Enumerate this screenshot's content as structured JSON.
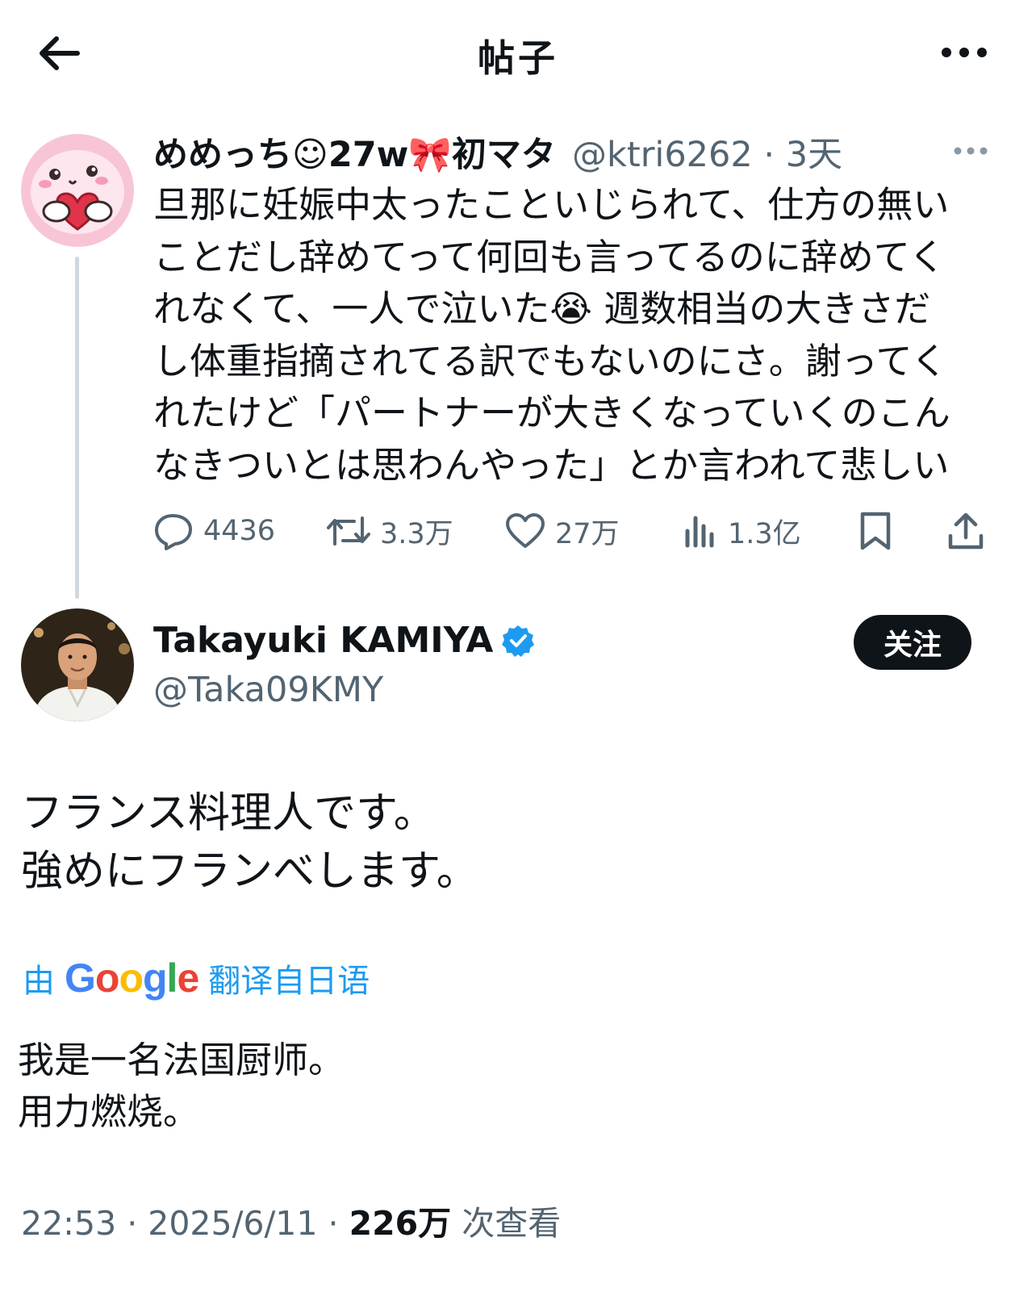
{
  "header": {
    "title": "帖子"
  },
  "parent_tweet": {
    "display_name": "めめっち☺27w🎀初マタ",
    "handle_time": "@ktri6262 · 3天",
    "text_lines": [
      "旦那に妊娠中太ったこといじられて、仕方の無い",
      "ことだし辞めてって何回も言ってるのに辞めてく",
      "れなくて、一人で泣いた😭 週数相当の大きさだ",
      "し体重指摘されてる訳でもないのにさ。謝ってく",
      "れたけど「パートナーが大きくなっていくのこん",
      "なきついとは思わんやった」とか言われて悲しい"
    ],
    "stats": {
      "replies": "4436",
      "reposts": "3.3万",
      "likes": "27万",
      "views": "1.3亿"
    }
  },
  "main_tweet": {
    "display_name": "Takayuki KAMIYA",
    "handle": "@Taka09KMY",
    "follow_label": "关注",
    "text_lines": [
      "フランス料理人です。",
      "強めにフランべします。"
    ],
    "translate": {
      "prefix": "由",
      "brand": "Google",
      "suffix": "翻译自日语"
    },
    "translated_lines": [
      "我是一名法国厨师。",
      "用力燃烧。"
    ],
    "meta": {
      "time_date": "22:53 · 2025/6/11 · ",
      "views_count": "226万",
      "views_label": " 次查看"
    }
  },
  "colors": {
    "text_primary": "#0f1419",
    "text_secondary": "#536471",
    "link_blue": "#1d9bf0",
    "verified_blue": "#1d9bf0",
    "follow_bg": "#0f1419"
  }
}
